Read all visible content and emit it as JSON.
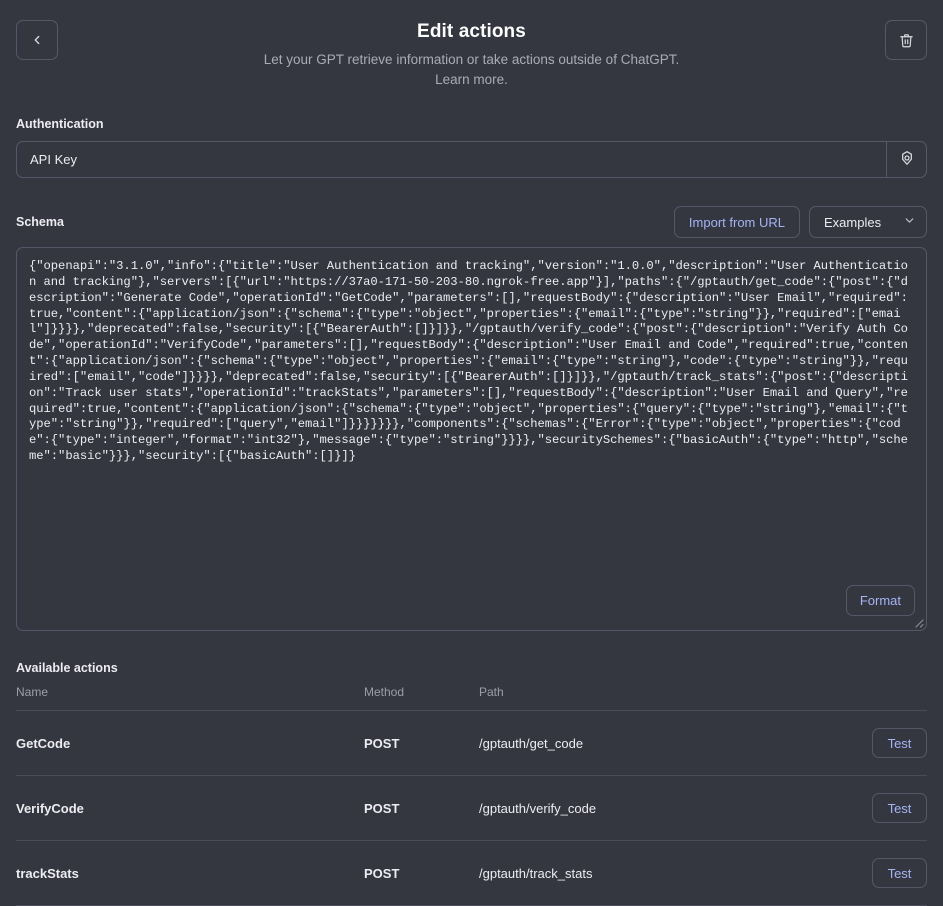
{
  "header": {
    "title": "Edit actions",
    "subtitle": "Let your GPT retrieve information or take actions outside of ChatGPT.",
    "learn_more": "Learn more.",
    "back_icon": "chevron-left-icon",
    "delete_icon": "trash-icon"
  },
  "authentication": {
    "label": "Authentication",
    "value": "API Key",
    "settings_icon": "gear-icon"
  },
  "schema": {
    "label": "Schema",
    "import_button": "Import from URL",
    "examples_select": "Examples",
    "format_button": "Format",
    "content": "{\"openapi\":\"3.1.0\",\"info\":{\"title\":\"User Authentication and tracking\",\"version\":\"1.0.0\",\"description\":\"User Authentication and tracking\"},\"servers\":[{\"url\":\"https://37a0-171-50-203-80.ngrok-free.app\"}],\"paths\":{\"/gptauth/get_code\":{\"post\":{\"description\":\"Generate Code\",\"operationId\":\"GetCode\",\"parameters\":[],\"requestBody\":{\"description\":\"User Email\",\"required\":true,\"content\":{\"application/json\":{\"schema\":{\"type\":\"object\",\"properties\":{\"email\":{\"type\":\"string\"}},\"required\":[\"email\"]}}}},\"deprecated\":false,\"security\":[{\"BearerAuth\":[]}]}},\"/gptauth/verify_code\":{\"post\":{\"description\":\"Verify Auth Code\",\"operationId\":\"VerifyCode\",\"parameters\":[],\"requestBody\":{\"description\":\"User Email and Code\",\"required\":true,\"content\":{\"application/json\":{\"schema\":{\"type\":\"object\",\"properties\":{\"email\":{\"type\":\"string\"},\"code\":{\"type\":\"string\"}},\"required\":[\"email\",\"code\"]}}}},\"deprecated\":false,\"security\":[{\"BearerAuth\":[]}]}},\"/gptauth/track_stats\":{\"post\":{\"description\":\"Track user stats\",\"operationId\":\"trackStats\",\"parameters\":[],\"requestBody\":{\"description\":\"User Email and Query\",\"required\":true,\"content\":{\"application/json\":{\"schema\":{\"type\":\"object\",\"properties\":{\"query\":{\"type\":\"string\"},\"email\":{\"type\":\"string\"}},\"required\":[\"query\",\"email\"]}}}}}}},\"components\":{\"schemas\":{\"Error\":{\"type\":\"object\",\"properties\":{\"code\":{\"type\":\"integer\",\"format\":\"int32\"},\"message\":{\"type\":\"string\"}}}},\"securitySchemes\":{\"basicAuth\":{\"type\":\"http\",\"scheme\":\"basic\"}}},\"security\":[{\"basicAuth\":[]}]}"
  },
  "available_actions": {
    "label": "Available actions",
    "columns": {
      "name": "Name",
      "method": "Method",
      "path": "Path",
      "action": ""
    },
    "rows": [
      {
        "name": "GetCode",
        "method": "POST",
        "path": "/gptauth/get_code",
        "test_label": "Test"
      },
      {
        "name": "VerifyCode",
        "method": "POST",
        "path": "/gptauth/verify_code",
        "test_label": "Test"
      },
      {
        "name": "trackStats",
        "method": "POST",
        "path": "/gptauth/track_stats",
        "test_label": "Test"
      }
    ]
  },
  "colors": {
    "background": "#353740",
    "border": "#565869",
    "text": "#ececf1",
    "muted": "#a9abb5",
    "accent": "#a4b4f3"
  }
}
